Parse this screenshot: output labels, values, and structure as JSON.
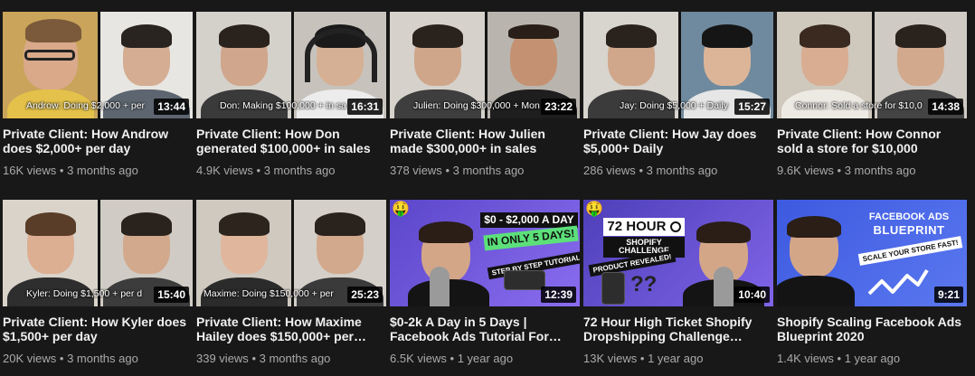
{
  "videos": [
    {
      "title": "Private Client: How Androw does $2,000+ per day",
      "views": "16K views",
      "age": "3 months ago",
      "duration": "13:44",
      "caption": "Androw: Doing $2,000 + per"
    },
    {
      "title": "Private Client: How Don generated $100,000+ in sales",
      "views": "4.9K views",
      "age": "3 months ago",
      "duration": "16:31",
      "caption": "Don: Making $100,000 + in sa"
    },
    {
      "title": "Private Client: How Julien made $300,000+ in sales",
      "views": "378 views",
      "age": "3 months ago",
      "duration": "23:22",
      "caption": "Julien: Doing $300,000 + Mon"
    },
    {
      "title": "Private Client: How Jay does $5,000+ Daily",
      "views": "286 views",
      "age": "3 months ago",
      "duration": "15:27",
      "caption": "Jay: Doing $5,000 + Daily"
    },
    {
      "title": "Private Client: How Connor sold a store for $10,000",
      "views": "9.6K views",
      "age": "3 months ago",
      "duration": "14:38",
      "caption": "Connor: Sold a store for $10,0"
    },
    {
      "title": "Private Client: How Kyler does $1,500+ per day",
      "views": "20K views",
      "age": "3 months ago",
      "duration": "15:40",
      "caption": "Kyler: Doing $1,500 + per d"
    },
    {
      "title": "Private Client: How Maxime Hailey does $150,000+ per…",
      "views": "339 views",
      "age": "3 months ago",
      "duration": "25:23",
      "caption": "Maxime: Doing $150,000 + per"
    },
    {
      "title": "$0-2k A Day in 5 Days | Facebook Ads Tutorial For…",
      "views": "6.5K views",
      "age": "1 year ago",
      "duration": "12:39",
      "promo_main": "$0 - $2,000 A DAY",
      "promo_sub": "IN ONLY 5 DAYS!",
      "promo_tag": "STEP BY STEP TUTORIAL"
    },
    {
      "title": "72 Hour High Ticket Shopify Dropshipping Challenge…",
      "views": "13K views",
      "age": "1 year ago",
      "duration": "10:40",
      "promo_main": "72 HOUR",
      "promo_sub": "SHOPIFY CHALLENGE",
      "promo_tag": "PRODUCT REVEALED!"
    },
    {
      "title": "Shopify Scaling Facebook Ads Blueprint 2020",
      "views": "1.4K views",
      "age": "1 year ago",
      "duration": "9:21",
      "promo_main": "FACEBOOK ADS",
      "promo_sub": "BLUEPRINT",
      "promo_tag": "SCALE YOUR STORE FAST!"
    }
  ],
  "meta_separator": "•",
  "colors": {
    "background": "#181818",
    "title": "#f1f1f1",
    "meta": "#aaaaaa",
    "promo_purple": "#6a4fd8"
  },
  "icons": {
    "promo_emoji": "money-face-icon",
    "clock": "clock-icon",
    "arrow": "growth-arrow-icon"
  }
}
